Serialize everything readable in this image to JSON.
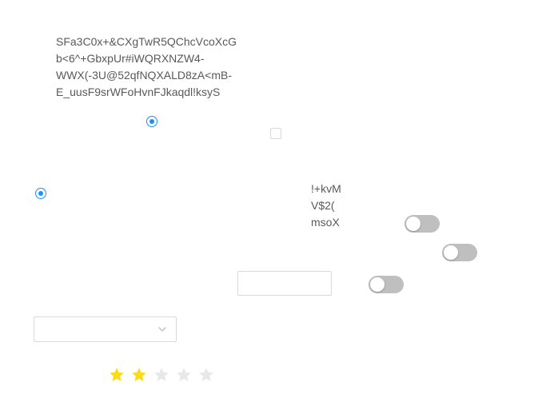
{
  "paragraph_main": "SFa3C0x+&CXgTwR5QChcVcoXcG\nb<6^+GbxpUr#iWQRXNZW4-\nWWX(-3U@52qfNQXALD8zA<mB-\nE_uusF9srWFoHvnFJkaqdl!ksyS",
  "paragraph_small": "!+kvM\nV$2(\nmsoX",
  "text_input": {
    "value": "",
    "placeholder": ""
  },
  "select": {
    "value": ""
  },
  "rating": {
    "value": 2,
    "max": 5
  },
  "radios": [
    {
      "checked": true
    },
    {
      "checked": true
    }
  ],
  "checkbox": {
    "checked": false
  },
  "switches": [
    {
      "on": false
    },
    {
      "on": false
    },
    {
      "on": false
    }
  ],
  "colors": {
    "accent": "#1890ff",
    "star_filled": "#fadb14",
    "star_empty": "#e8e8e8",
    "switch_off": "#bfbfbf",
    "border": "#d9d9d9"
  }
}
